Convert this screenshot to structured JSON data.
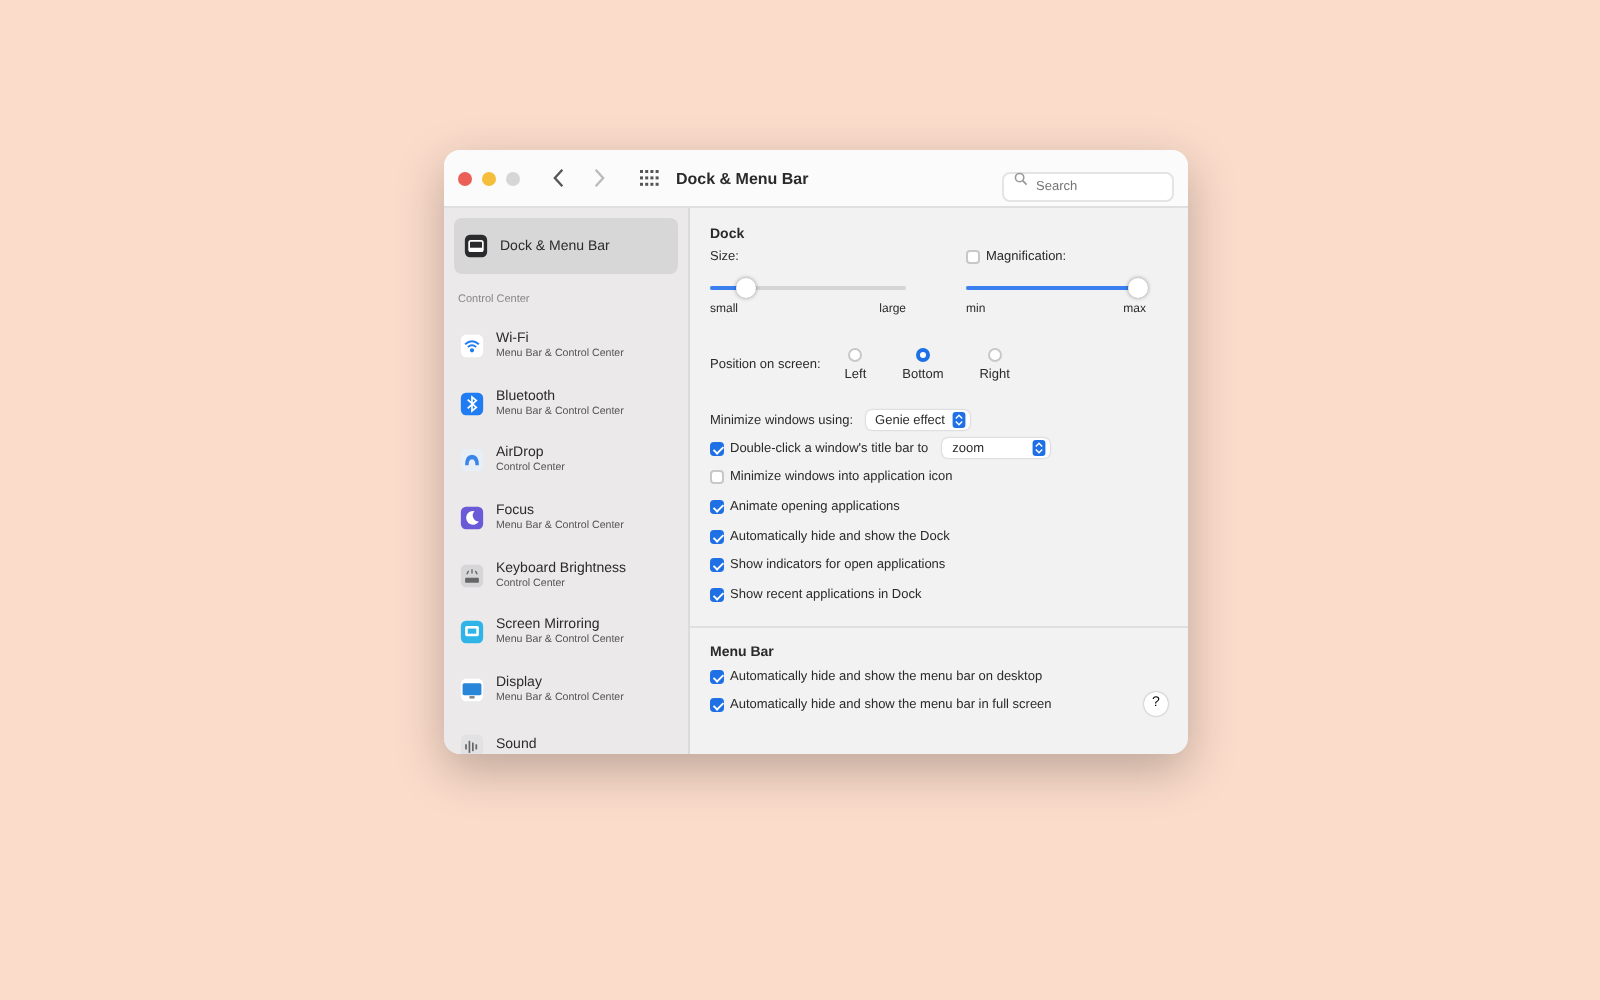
{
  "window": {
    "title": "Dock & Menu Bar",
    "search": {
      "placeholder": "Search"
    }
  },
  "sidebar": {
    "top_item": {
      "label": "Dock & Menu Bar",
      "selected": true
    },
    "section": "Control Center",
    "items": [
      {
        "title": "Wi-Fi",
        "subtitle": "Menu Bar & Control Center",
        "selected": false
      },
      {
        "title": "Bluetooth",
        "subtitle": "Menu Bar & Control Center",
        "selected": false
      },
      {
        "title": "AirDrop",
        "subtitle": "Control Center",
        "selected": false
      },
      {
        "title": "Focus",
        "subtitle": "Menu Bar & Control Center",
        "selected": false
      },
      {
        "title": "Keyboard Brightness",
        "subtitle": "Control Center",
        "selected": false
      },
      {
        "title": "Screen Mirroring",
        "subtitle": "Menu Bar & Control Center",
        "selected": false
      },
      {
        "title": "Display",
        "subtitle": "Menu Bar & Control Center",
        "selected": false
      },
      {
        "title": "Sound",
        "selected": false
      }
    ]
  },
  "dock": {
    "title": "Dock",
    "size": {
      "label": "Size:",
      "level": 0.18,
      "min": "small",
      "max": "large"
    },
    "magnification": {
      "label": "Magnification:",
      "checked": false,
      "level": 0.95,
      "min": "min",
      "max": "max"
    },
    "position": {
      "label": "Position on screen:",
      "options": [
        {
          "label": "Left",
          "selected": false
        },
        {
          "label": "Bottom",
          "selected": true
        },
        {
          "label": "Right",
          "selected": false
        }
      ]
    },
    "minimize": {
      "label": "Minimize windows using:",
      "value": "Genie effect"
    },
    "options": [
      {
        "kind": "select",
        "label": "Double-click a window's title bar to",
        "checked": true,
        "value": "zoom"
      },
      {
        "kind": "check",
        "label": "Minimize windows into application icon",
        "checked": false
      },
      {
        "kind": "check",
        "label": "Animate opening applications",
        "checked": true
      },
      {
        "kind": "check",
        "label": "Automatically hide and show the Dock",
        "checked": true
      },
      {
        "kind": "check",
        "label": "Show indicators for open applications",
        "checked": true
      },
      {
        "kind": "check",
        "label": "Show recent applications in Dock",
        "checked": true
      }
    ]
  },
  "menu_bar": {
    "title": "Menu Bar",
    "options": [
      {
        "label": "Automatically hide and show the menu bar on desktop",
        "checked": true
      },
      {
        "label": "Automatically hide and show the menu bar in full screen",
        "checked": true
      }
    ]
  },
  "help": "?"
}
